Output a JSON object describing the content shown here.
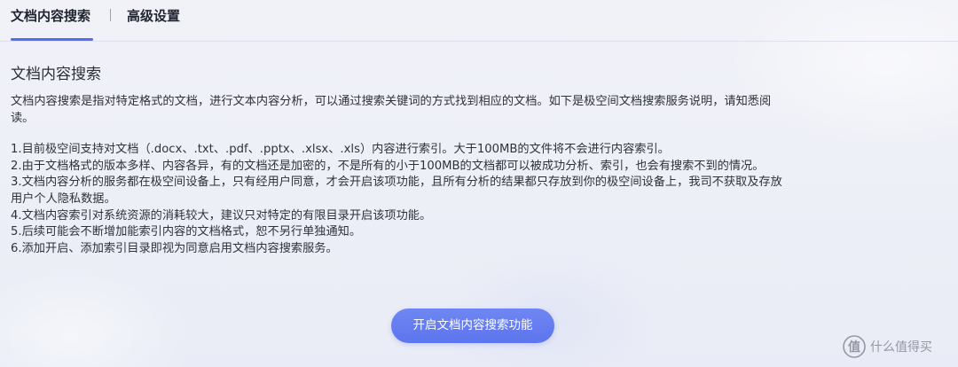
{
  "tabs": {
    "items": [
      {
        "label": "文档内容搜索",
        "active": true
      },
      {
        "label": "高级设置",
        "active": false
      }
    ]
  },
  "section": {
    "title": "文档内容搜索",
    "description_lines": [
      "文档内容搜索是指对特定格式的文档，进行文本内容分析，可以通过搜索关键词的方式找到相应的文档。如下是极空间文档搜索服务说明，请知悉阅",
      "读。"
    ],
    "rules": [
      "1.目前极空间支持对文档（.docx、.txt、.pdf、.pptx、.xlsx、.xls）内容进行索引。大于100MB的文件将不会进行内容索引。",
      "2.由于文档格式的版本多样、内容各异，有的文档还是加密的，不是所有的小于100MB的文档都可以被成功分析、索引，也会有搜索不到的情况。",
      "3.文档内容分析的服务都在极空间设备上，只有经用户同意，才会开启该项功能，且所有分析的结果都只存放到你的极空间设备上，我司不获取及存放",
      "用户个人隐私数据。",
      "4.文档内容索引对系统资源的消耗较大，建议只对特定的有限目录开启该项功能。",
      "5.后续可能会不断增加能索引内容的文档格式，恕不另行单独通知。",
      "6.添加开启、添加索引目录即视为同意启用文档内容搜索服务。"
    ]
  },
  "action": {
    "enable_label": "开启文档内容搜索功能"
  },
  "watermark": {
    "text": "什么值得买"
  },
  "colors": {
    "accent": "#5d75ee",
    "tab_indicator": "#4f6ff0",
    "text": "#2b2f38"
  }
}
